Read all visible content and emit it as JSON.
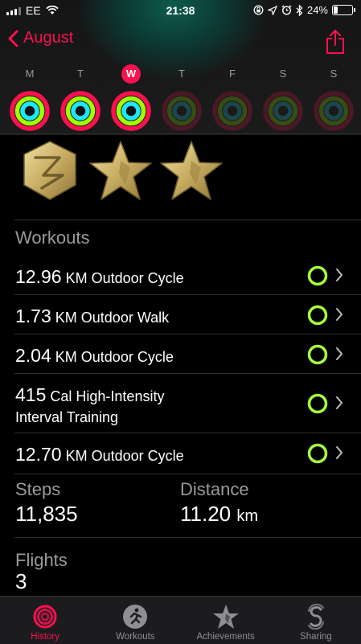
{
  "status": {
    "carrier": "EE",
    "time": "21:38",
    "battery": "24%",
    "battery_level": 0.24
  },
  "nav": {
    "back_label": "August"
  },
  "week": {
    "days": [
      {
        "letter": "M",
        "today": false,
        "filled": true
      },
      {
        "letter": "T",
        "today": false,
        "filled": true
      },
      {
        "letter": "W",
        "today": true,
        "filled": true
      },
      {
        "letter": "T",
        "today": false,
        "filled": false
      },
      {
        "letter": "F",
        "today": false,
        "filled": false
      },
      {
        "letter": "S",
        "today": false,
        "filled": false
      },
      {
        "letter": "S",
        "today": false,
        "filled": false
      }
    ]
  },
  "awards": [
    "hexagon-award-icon",
    "star-award-icon",
    "star-award-icon"
  ],
  "workouts": {
    "title": "Workouts",
    "items": [
      {
        "value": "12.96",
        "text": "KM Outdoor Cycle",
        "text2": ""
      },
      {
        "value": "1.73",
        "text": "KM Outdoor Walk",
        "text2": ""
      },
      {
        "value": "2.04",
        "text": "KM Outdoor Cycle",
        "text2": ""
      },
      {
        "value": "415",
        "text": "Cal High-Intensity",
        "text2": "Interval Training"
      },
      {
        "value": "12.70",
        "text": "KM Outdoor Cycle",
        "text2": ""
      }
    ]
  },
  "stats": {
    "steps_label": "Steps",
    "steps_value": "11,835",
    "distance_label": "Distance",
    "distance_value": "11.20",
    "distance_unit": "km",
    "flights_label": "Flights",
    "flights_value": "3"
  },
  "tabs": [
    {
      "label": "History",
      "icon": "history-icon",
      "active": true
    },
    {
      "label": "Workouts",
      "icon": "workouts-icon",
      "active": false
    },
    {
      "label": "Achievements",
      "icon": "achievements-icon",
      "active": false
    },
    {
      "label": "Sharing",
      "icon": "sharing-icon",
      "active": false
    }
  ],
  "colors": {
    "accent": "#fa114f",
    "move": "#fa114f",
    "exercise": "#a0ff00",
    "stand": "#1ee6ff",
    "workout_ring": "#a6ff3c"
  }
}
